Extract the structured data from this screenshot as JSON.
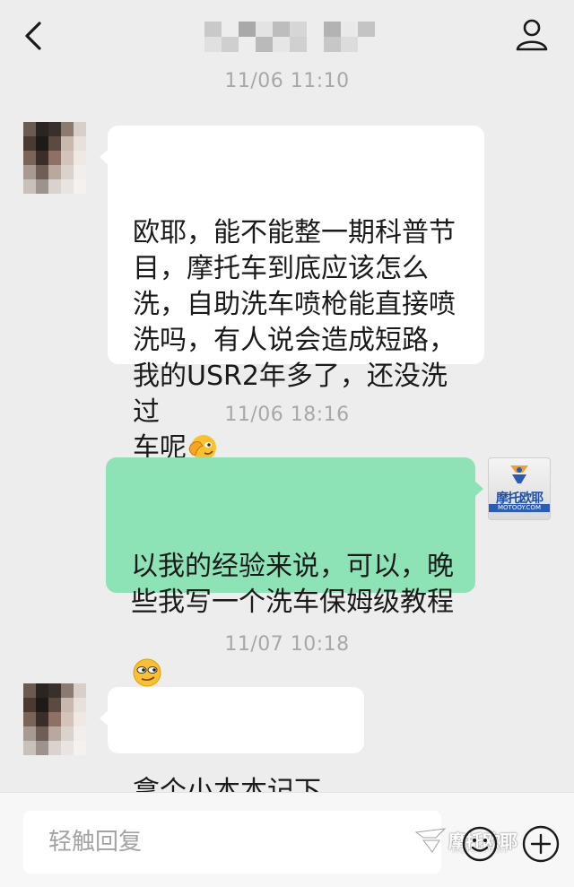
{
  "header": {
    "back_icon": "chevron-left-icon",
    "contact_name_hidden": true,
    "profile_icon": "person-icon"
  },
  "messages": [
    {
      "timestamp": "11/06 11:10",
      "direction": "incoming",
      "text": "欧耶，能不能整一期科普节\n目，摩托车到底应该怎么\n洗，自助洗车喷枪能直接喷\n洗吗，有人说会造成短路，\n我的USR2年多了，还没洗过\n车呢",
      "trailing_emoji": "facepalm-emoji"
    },
    {
      "timestamp": "11/06 18:16",
      "direction": "outgoing",
      "text": "以我的经验来说，可以，晚\n些我写一个洗车保姆级教程",
      "trailing_emoji": "smirk-emoji"
    },
    {
      "timestamp": "11/07 10:18",
      "direction": "incoming",
      "text": "拿个小本本记下来"
    }
  ],
  "own_avatar": {
    "brand": "摩托欧耶",
    "domain": "MOTOOY.COM"
  },
  "footer": {
    "reply_placeholder": "轻触回复",
    "emoji_button_icon": "smiley-icon",
    "plus_button_icon": "plus-circle-icon"
  },
  "watermark": {
    "text": "摩托欧耶",
    "sub": "MOTOOY.COM"
  },
  "colors": {
    "background": "#ededed",
    "incoming_bubble": "#ffffff",
    "outgoing_bubble": "#8ee3b6",
    "timestamp": "#a8a8a8"
  }
}
